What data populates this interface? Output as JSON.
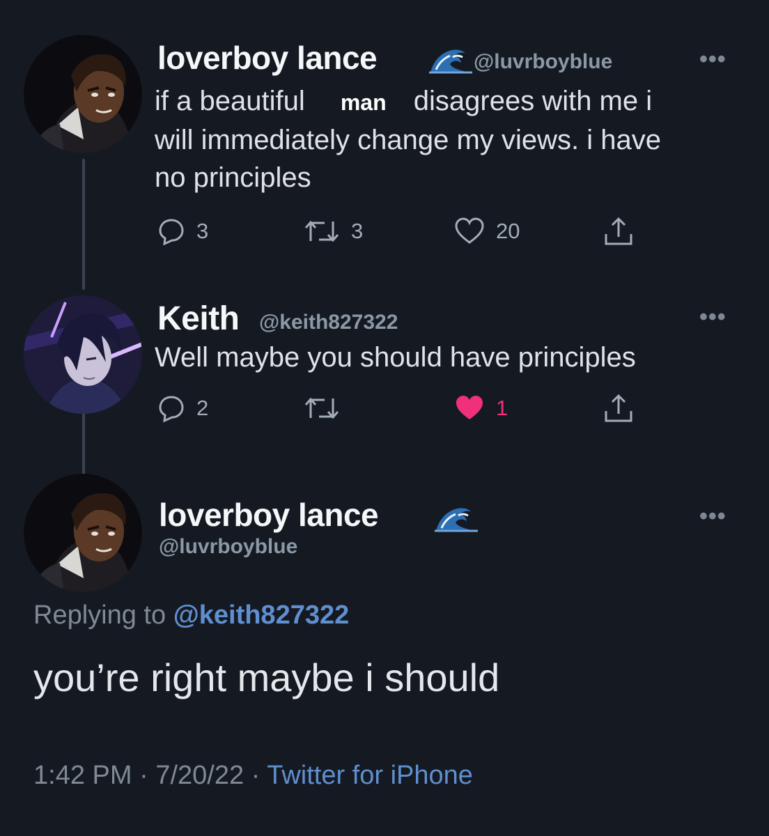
{
  "tweets": [
    {
      "display_name": "loverboy lance",
      "handle": "@luvrboyblue",
      "text_before": "if a beautiful",
      "text_highlight": "man",
      "text_after": "disagrees with me i",
      "text_line2": "will immediately change my views. i have",
      "text_line3": "no principles",
      "replies": "3",
      "retweets": "3",
      "likes": "20"
    },
    {
      "display_name": "Keith",
      "handle": "@keith827322",
      "text": "Well maybe you should have principles",
      "replies": "2",
      "likes": "1"
    }
  ],
  "focus_tweet": {
    "display_name": "loverboy lance",
    "handle": "@luvrboyblue",
    "replying_label": "Replying to",
    "replying_to": "@keith827322",
    "text": "you’re right maybe i should",
    "time": "1:42 PM",
    "separator": "·",
    "date": "7/20/22",
    "source": "Twitter for iPhone"
  },
  "ui": {
    "more_glyph": "•••"
  },
  "colors": {
    "background": "#151a22",
    "link": "#5f8fd0",
    "like_active": "#f0307a"
  }
}
